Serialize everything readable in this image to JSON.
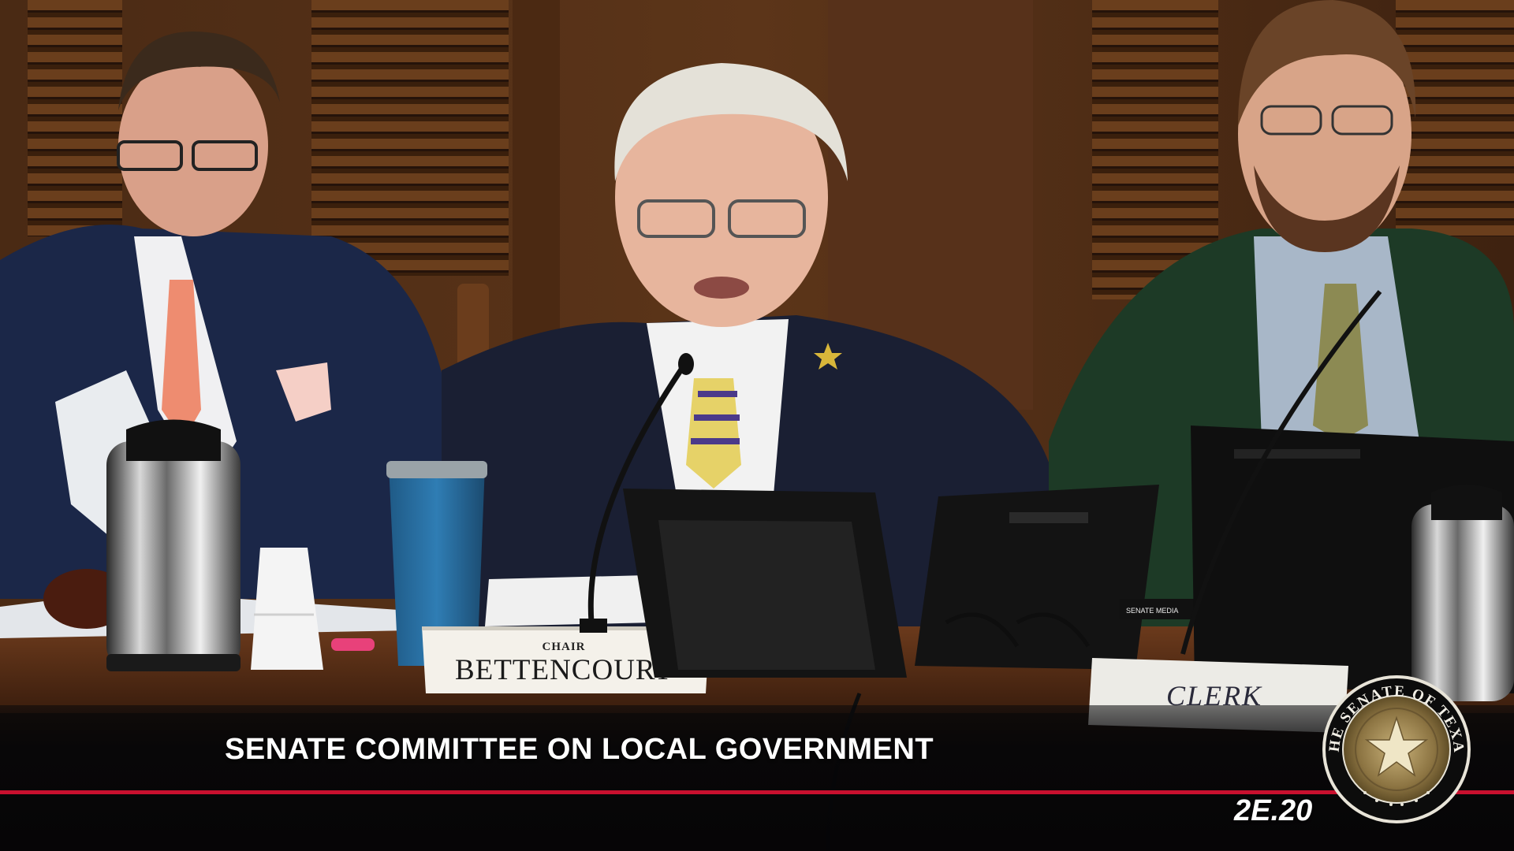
{
  "banner": {
    "title": "SENATE COMMITTEE ON LOCAL GOVERNMENT",
    "bill_number": "2E.20",
    "accent_color": "#c8102e"
  },
  "placards": {
    "chair_label": "CHAIR",
    "chair_name": "BETTENCOURT",
    "clerk": "CLERK"
  },
  "device_labels": {
    "senate_media": "SENATE MEDIA"
  },
  "seal": {
    "icon": "senate-of-texas-seal-icon",
    "text": "THE SENATE OF TEXAS"
  }
}
